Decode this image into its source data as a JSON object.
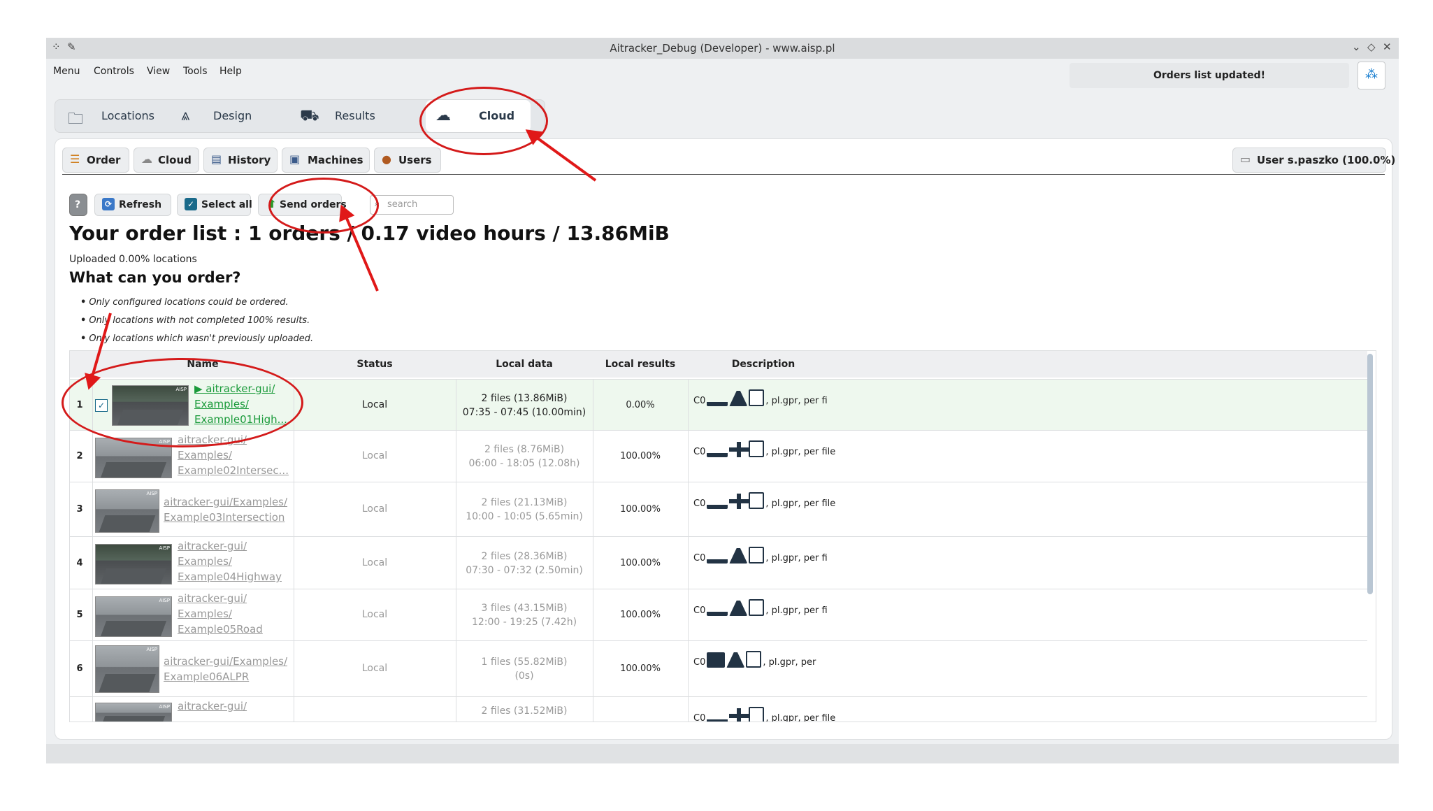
{
  "window": {
    "title": "Aitracker_Debug (Developer) - www.aisp.pl"
  },
  "menu": [
    "Menu",
    "Controls",
    "View",
    "Tools",
    "Help"
  ],
  "notification": "Orders list updated!",
  "main_tabs": [
    {
      "label": "Locations",
      "icon": "folder-icon"
    },
    {
      "label": "Design",
      "icon": "road-icon"
    },
    {
      "label": "Results",
      "icon": "results-icon"
    },
    {
      "label": "Cloud",
      "icon": "cloud-icon",
      "active": true
    }
  ],
  "sub_tabs": [
    {
      "label": "Order",
      "icon": "order-icon"
    },
    {
      "label": "Cloud",
      "icon": "cloud-icon"
    },
    {
      "label": "History",
      "icon": "history-icon"
    },
    {
      "label": "Machines",
      "icon": "machines-icon"
    },
    {
      "label": "Users",
      "icon": "users-icon"
    }
  ],
  "user_badge": "User s.paszko (100.0%)",
  "toolbar": {
    "help": "?",
    "refresh": "Refresh",
    "select_all": "Select all",
    "send_orders": "Send orders",
    "search_placeholder": "search"
  },
  "heading": "Your order list : 1 orders / 0.17 video hours / 13.86MiB",
  "uploaded": "Uploaded 0.00% locations",
  "subheading": "What can you order?",
  "notes": [
    "Only configured locations could be ordered.",
    "Only locations with not completed 100% results.",
    "Only locations which wasn't previously uploaded."
  ],
  "columns": [
    "Name",
    "Status",
    "Local data",
    "Local results",
    "Description"
  ],
  "rows": [
    {
      "num": "1",
      "name": [
        "▶ aitracker-gui/",
        "Examples/",
        "Example01High..."
      ],
      "status": "Local",
      "local_data": [
        "2  files (13.86MiB)",
        "07:35 - 07:45 (10.00min)"
      ],
      "results": "0.00%",
      "desc_prefix": "C0",
      "desc_suffix": ", pl.gpr, per fi",
      "checked": true
    },
    {
      "num": "2",
      "name": [
        "aitracker-gui/",
        "Examples/",
        "Example02Intersec..."
      ],
      "status": "Local",
      "local_data": [
        "2  files (8.76MiB)",
        "06:00 - 18:05 (12.08h)"
      ],
      "results": "100.00%",
      "desc_prefix": "C0",
      "desc_suffix": ", pl.gpr, per file"
    },
    {
      "num": "3",
      "name": [
        "aitracker-gui/Examples/",
        "Example03Intersection"
      ],
      "status": "Local",
      "local_data": [
        "2  files (21.13MiB)",
        "10:00 - 10:05 (5.65min)"
      ],
      "results": "100.00%",
      "desc_prefix": "C0",
      "desc_suffix": ", pl.gpr, per file"
    },
    {
      "num": "4",
      "name": [
        "aitracker-gui/",
        "Examples/",
        "Example04Highway"
      ],
      "status": "Local",
      "local_data": [
        "2  files (28.36MiB)",
        "07:30 - 07:32 (2.50min)"
      ],
      "results": "100.00%",
      "desc_prefix": "C0",
      "desc_suffix": ", pl.gpr, per fi"
    },
    {
      "num": "5",
      "name": [
        "aitracker-gui/",
        "Examples/",
        "Example05Road"
      ],
      "status": "Local",
      "local_data": [
        "3  files (43.15MiB)",
        "12:00 - 19:25 (7.42h)"
      ],
      "results": "100.00%",
      "desc_prefix": "C0",
      "desc_suffix": ", pl.gpr, per fi"
    },
    {
      "num": "6",
      "name": [
        "aitracker-gui/Examples/",
        "Example06ALPR"
      ],
      "status": "Local",
      "local_data": [
        "1  files (55.82MiB)",
        "(0s)"
      ],
      "results": "100.00%",
      "desc_prefix": "C0",
      "desc_suffix": ", pl.gpr, per "
    },
    {
      "num": "",
      "name": [
        "aitracker-gui/"
      ],
      "status": "",
      "local_data": [
        "2  files (31.52MiB)"
      ],
      "results": "",
      "desc_prefix": "C0",
      "desc_suffix": ", pl.gpr, per file"
    }
  ]
}
